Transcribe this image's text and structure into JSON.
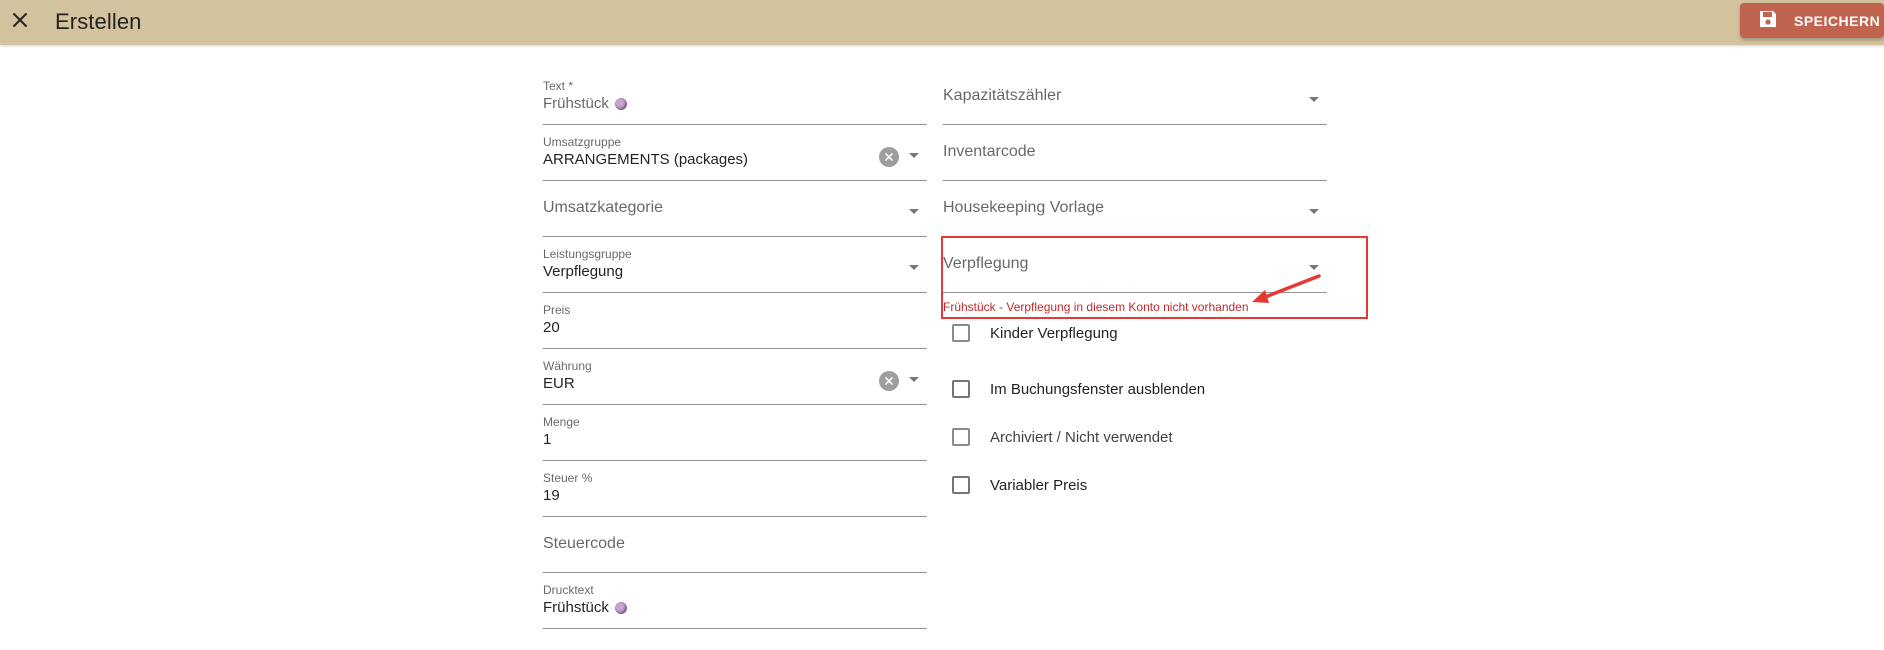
{
  "header": {
    "title": "Erstellen",
    "save_label": "SPEICHERN",
    "close_icon": "close-icon",
    "save_icon": "save-icon",
    "background_color": "#d3c29e",
    "save_button_color": "#c0644f"
  },
  "left_fields": {
    "text": {
      "label": "Text *",
      "value": "Frühstück"
    },
    "umsatzgruppe": {
      "label": "Umsatzgruppe",
      "value": "ARRANGEMENTS (packages)"
    },
    "umsatzkategorie": {
      "label": "Umsatzkategorie"
    },
    "leistungsgruppe": {
      "label": "Leistungsgruppe",
      "value": "Verpflegung"
    },
    "preis": {
      "label": "Preis",
      "value": "20"
    },
    "waehrung": {
      "label": "Währung",
      "value": "EUR"
    },
    "menge": {
      "label": "Menge",
      "value": "1"
    },
    "steuer": {
      "label": "Steuer %",
      "value": "19"
    },
    "steuercode": {
      "label": "Steuercode"
    },
    "drucktext": {
      "label": "Drucktext",
      "value": "Frühstück"
    }
  },
  "right_fields": {
    "kapazitaetszaehler": {
      "label": "Kapazitätszähler"
    },
    "inventarcode": {
      "label": "Inventarcode"
    },
    "housekeeping": {
      "label": "Housekeeping Vorlage"
    },
    "verpflegung": {
      "label": "Verpflegung",
      "error": "Frühstück - Verpflegung in diesem Konto nicht vorhanden"
    }
  },
  "checkboxes": [
    {
      "label": "Kinder Verpflegung",
      "checked": false
    },
    {
      "label": "Im Buchungsfenster ausblenden",
      "checked": false
    },
    {
      "label": "Archiviert / Nicht verwendet",
      "checked": false
    },
    {
      "label": "Variabler Preis",
      "checked": false
    }
  ],
  "annotation_color": "#e53935"
}
